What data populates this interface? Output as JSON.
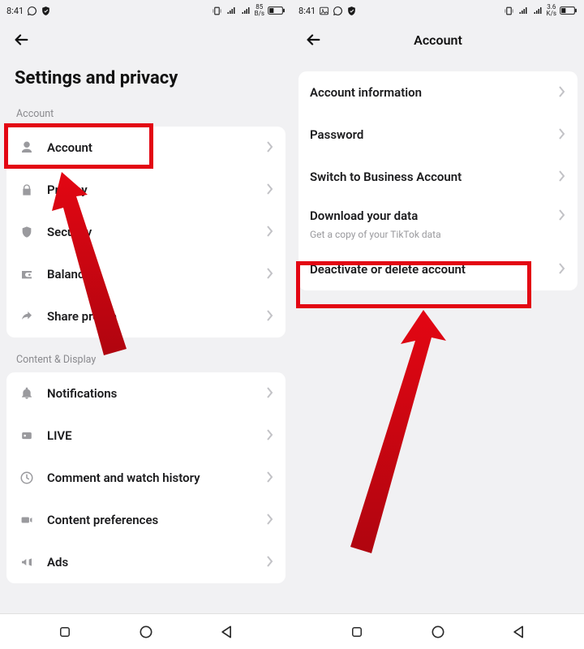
{
  "left": {
    "statusbar": {
      "time": "8:41"
    },
    "page_title": "Settings and privacy",
    "sections": {
      "account": {
        "label": "Account",
        "items": [
          {
            "label": "Account"
          },
          {
            "label": "Privacy"
          },
          {
            "label": "Security"
          },
          {
            "label": "Balance"
          },
          {
            "label": "Share profile"
          }
        ]
      },
      "content_display": {
        "label": "Content & Display",
        "items": [
          {
            "label": "Notifications"
          },
          {
            "label": "LIVE"
          },
          {
            "label": "Comment and watch history"
          },
          {
            "label": "Content preferences"
          },
          {
            "label": "Ads"
          }
        ]
      }
    }
  },
  "right": {
    "statusbar": {
      "time": "8:41"
    },
    "header_title": "Account",
    "card": {
      "items": [
        {
          "label": "Account information"
        },
        {
          "label": "Password"
        },
        {
          "label": "Switch to Business Account"
        },
        {
          "label": "Download your data",
          "sub": "Get a copy of your TikTok data"
        },
        {
          "label": "Deactivate or delete account"
        }
      ]
    }
  },
  "annotations": {
    "highlight_color": "#e30613"
  }
}
